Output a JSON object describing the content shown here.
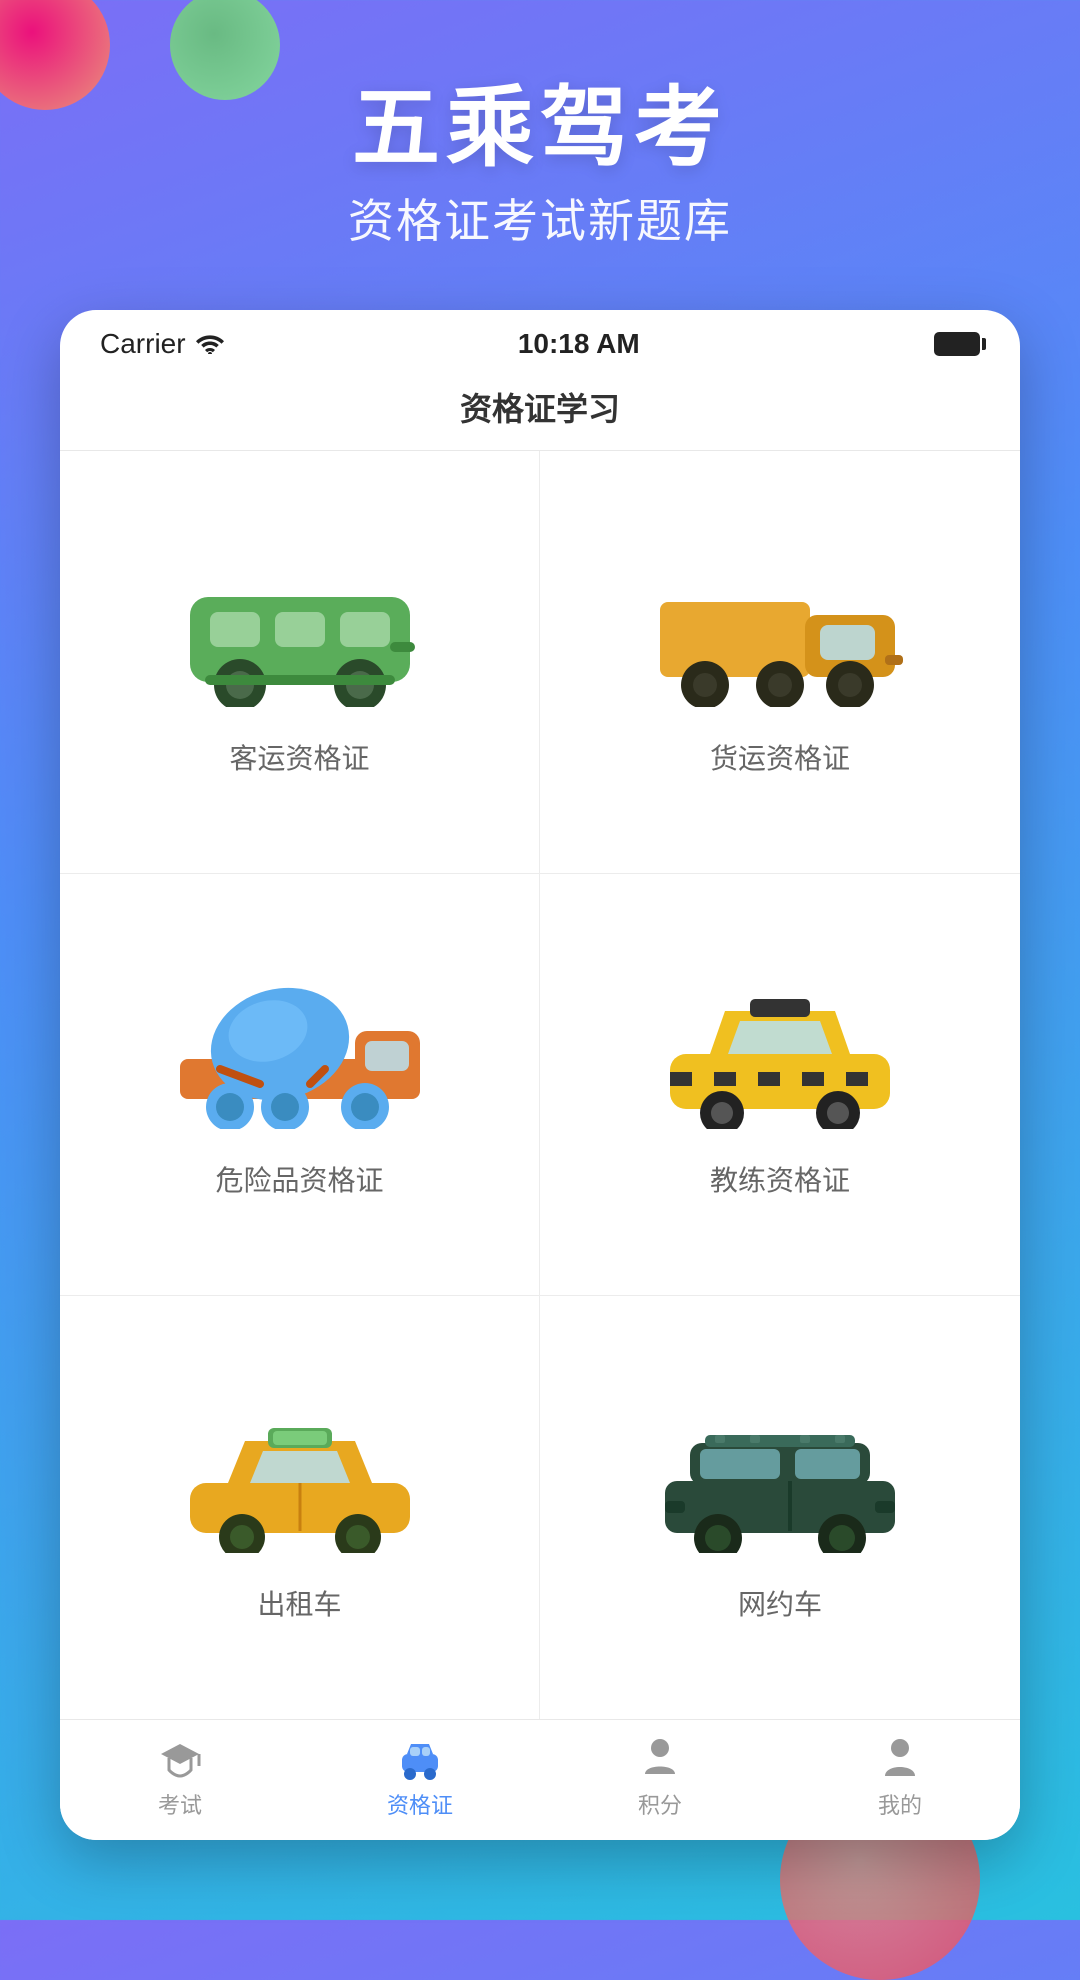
{
  "app": {
    "title_main": "五乘驾考",
    "title_sub": "资格证考试新题库",
    "page_title": "资格证学习"
  },
  "status_bar": {
    "carrier": "Carrier",
    "time": "10:18 AM"
  },
  "grid_items": [
    {
      "id": "passenger",
      "label": "客运资格证",
      "vehicle_type": "bus"
    },
    {
      "id": "freight",
      "label": "货运资格证",
      "vehicle_type": "truck"
    },
    {
      "id": "hazmat",
      "label": "危险品资格证",
      "vehicle_type": "mixer"
    },
    {
      "id": "trainer",
      "label": "教练资格证",
      "vehicle_type": "taxi_checker"
    },
    {
      "id": "taxi",
      "label": "出租车",
      "vehicle_type": "taxi_yellow"
    },
    {
      "id": "rideshare",
      "label": "网约车",
      "vehicle_type": "suv"
    }
  ],
  "tabs": [
    {
      "id": "exam",
      "label": "考试",
      "active": false
    },
    {
      "id": "certificate",
      "label": "资格证",
      "active": true
    },
    {
      "id": "points",
      "label": "积分",
      "active": false
    },
    {
      "id": "mine",
      "label": "我的",
      "active": false
    }
  ],
  "colors": {
    "active_tab": "#4e8ef7",
    "inactive_tab": "#999999",
    "bg_gradient_start": "#7b6ef6",
    "bg_gradient_end": "#29c0e0"
  }
}
